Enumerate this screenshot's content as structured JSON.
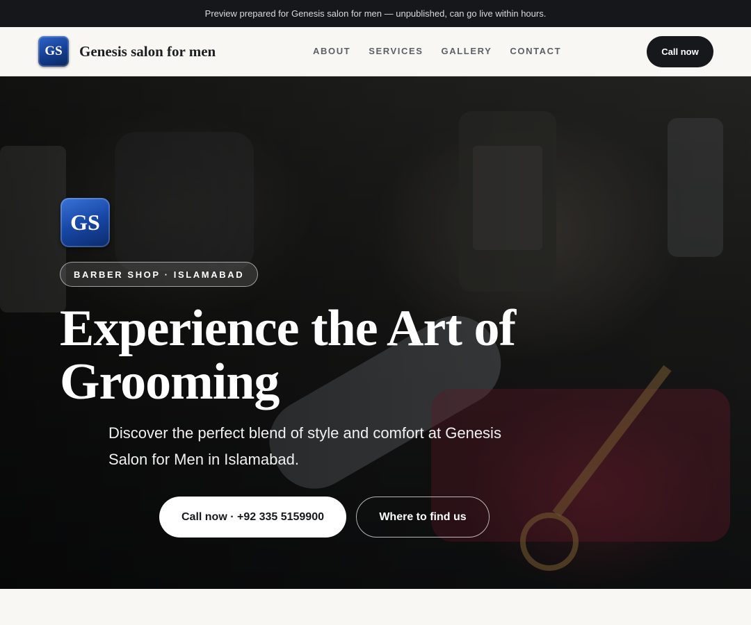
{
  "banner": {
    "text": "Preview prepared for Genesis salon for men — unpublished, can go live within hours."
  },
  "brand": {
    "logo_text": "GS",
    "name": "Genesis salon for men"
  },
  "nav": {
    "links": [
      "ABOUT",
      "SERVICES",
      "GALLERY",
      "CONTACT"
    ],
    "cta_label": "Call now"
  },
  "hero": {
    "logo_text": "GS",
    "tag": "BARBER SHOP · ISLAMABAD",
    "headline": "Experience the Art of Grooming",
    "subtitle": "Discover the perfect blend of style and comfort at Genesis Salon for Men in Islamabad.",
    "primary_button": "Call now · +92 335 5159900",
    "secondary_button": "Where to find us",
    "background_icon": "barber-tools-photo"
  },
  "colors": {
    "dark": "#16181c",
    "logo_blue": "#1747a6",
    "page_bg": "#f8f7f3"
  }
}
